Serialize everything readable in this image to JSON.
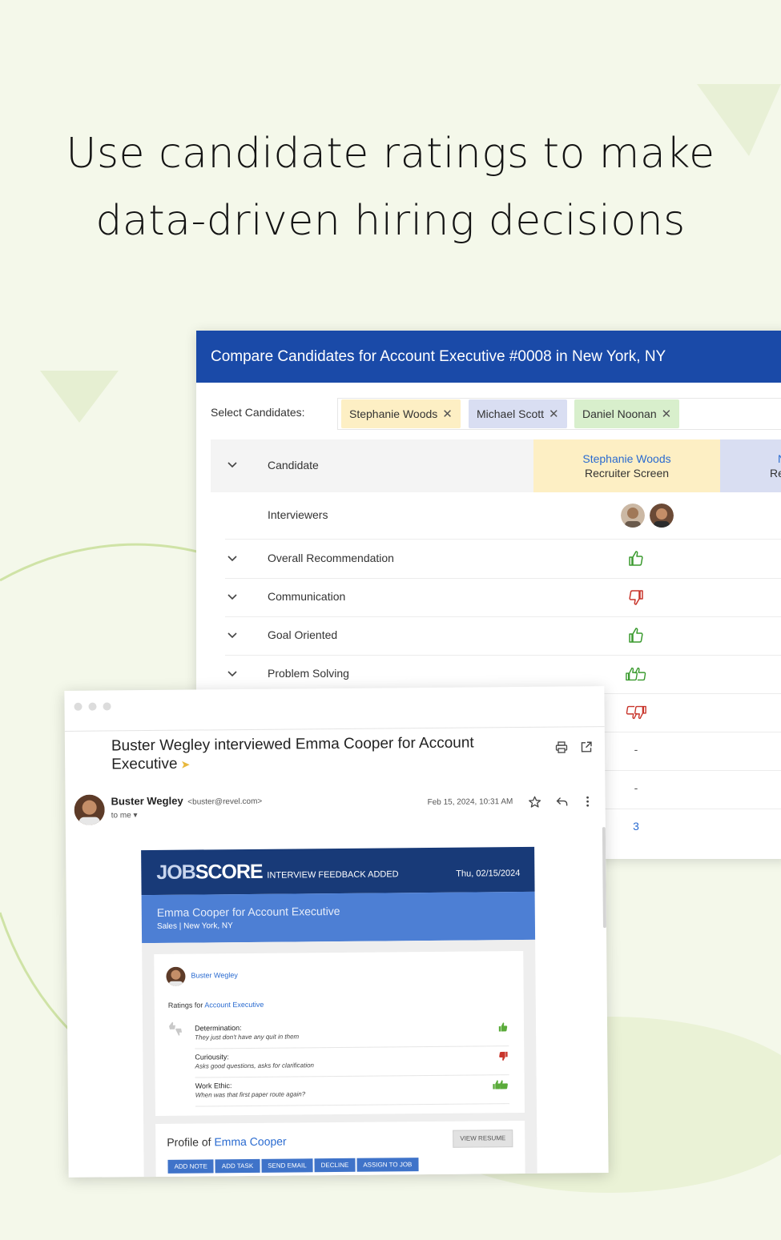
{
  "headline": {
    "line1": "Use candidate ratings to make",
    "line2": "data-driven hiring decisions"
  },
  "compare": {
    "title": "Compare Candidates for Account Executive #0008 in New York, NY",
    "select_label": "Select Candidates:",
    "chips": [
      {
        "label": "Stephanie Woods",
        "color": "#fdefc4"
      },
      {
        "label": "Michael Scott",
        "color": "#d9def2"
      },
      {
        "label": "Daniel Noonan",
        "color": "#d8efcc"
      }
    ],
    "table": {
      "head_label": "Candidate",
      "col1_name": "Stephanie Woods",
      "col1_stage": "Recruiter Screen",
      "col2_name": "N",
      "col2_stage": "Re",
      "rows": [
        {
          "label": "Interviewers"
        },
        {
          "label": "Overall Recommendation",
          "rating": "thumbs-up"
        },
        {
          "label": "Communication",
          "rating": "thumbs-down"
        },
        {
          "label": "Goal Oriented",
          "rating": "thumbs-up"
        },
        {
          "label": "Problem Solving",
          "rating": "double-thumbs-up"
        },
        {
          "label": "",
          "rating": "double-thumbs-down"
        },
        {
          "label": "",
          "value": "-"
        },
        {
          "label": "",
          "value": "-"
        },
        {
          "label": "",
          "value": "3"
        }
      ]
    }
  },
  "email": {
    "subject": "Buster Wegley interviewed Emma Cooper for Account Executive",
    "sender_name": "Buster Wegley",
    "sender_email": "<buster@revel.com>",
    "to": "to me",
    "date": "Feb 15, 2024, 10:31 AM",
    "notification": {
      "logo_bold": "JOB",
      "logo_light": "SCORE",
      "tag": "INTERVIEW FEEDBACK ADDED",
      "date": "Thu, 02/15/2024",
      "title": "Emma Cooper for Account Executive",
      "subtitle": "Sales | New York, NY",
      "reviewer": "Buster Wegley",
      "ratings_for_prefix": "Ratings for",
      "ratings_for_job": "Account Executive",
      "ratings": [
        {
          "name": "Determination:",
          "comment": "They just don't have any quit in them",
          "rating": "thumbs-up"
        },
        {
          "name": "Curiousity:",
          "comment": "Asks good questions, asks for clarification",
          "rating": "thumbs-down"
        },
        {
          "name": "Work Ethic:",
          "comment": "When was that first paper route again?",
          "rating": "double-thumbs-up"
        }
      ],
      "profile_prefix": "Profile of",
      "profile_name": "Emma Cooper",
      "view_resume": "VIEW RESUME",
      "actions": [
        "ADD NOTE",
        "ADD TASK",
        "SEND EMAIL",
        "DECLINE",
        "ASSIGN TO JOB"
      ]
    }
  },
  "colors": {
    "header_blue": "#1a4aa8",
    "positive": "#3a9a2e",
    "negative": "#c8352b",
    "link": "#2a6bd0",
    "background": "#f4f8ea"
  }
}
